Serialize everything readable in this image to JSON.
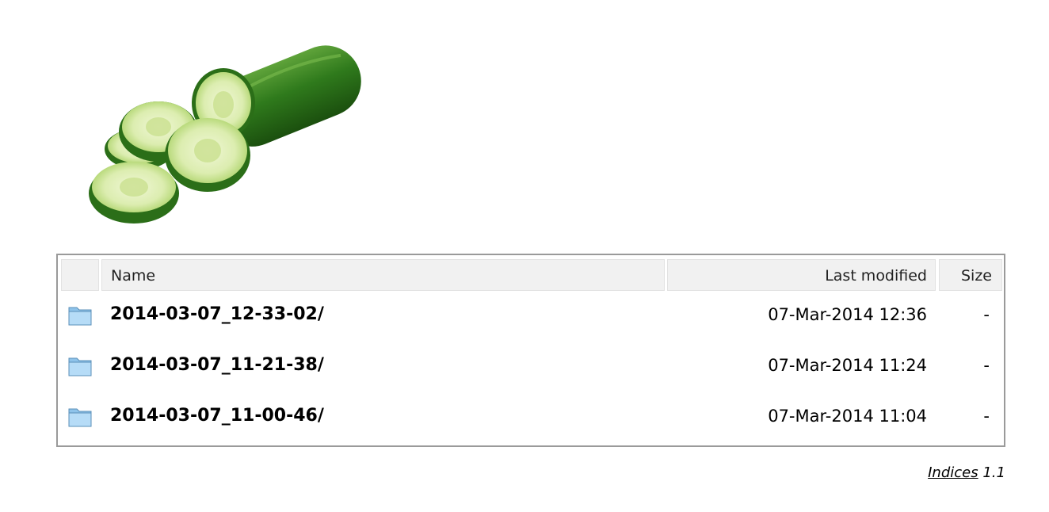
{
  "header": {
    "icon_col": "",
    "name": "Name",
    "modified": "Last modified",
    "size": "Size"
  },
  "entries": [
    {
      "name": "2014-03-07_12-33-02/",
      "modified": "07-Mar-2014 12:36",
      "size": "-",
      "icon": "folder-icon"
    },
    {
      "name": "2014-03-07_11-21-38/",
      "modified": "07-Mar-2014 11:24",
      "size": "-",
      "icon": "folder-icon"
    },
    {
      "name": "2014-03-07_11-00-46/",
      "modified": "07-Mar-2014 11:04",
      "size": "-",
      "icon": "folder-icon"
    }
  ],
  "footer": {
    "link_label": "Indices",
    "version": "1.1"
  },
  "logo": {
    "icon": "cucumber-logo"
  }
}
